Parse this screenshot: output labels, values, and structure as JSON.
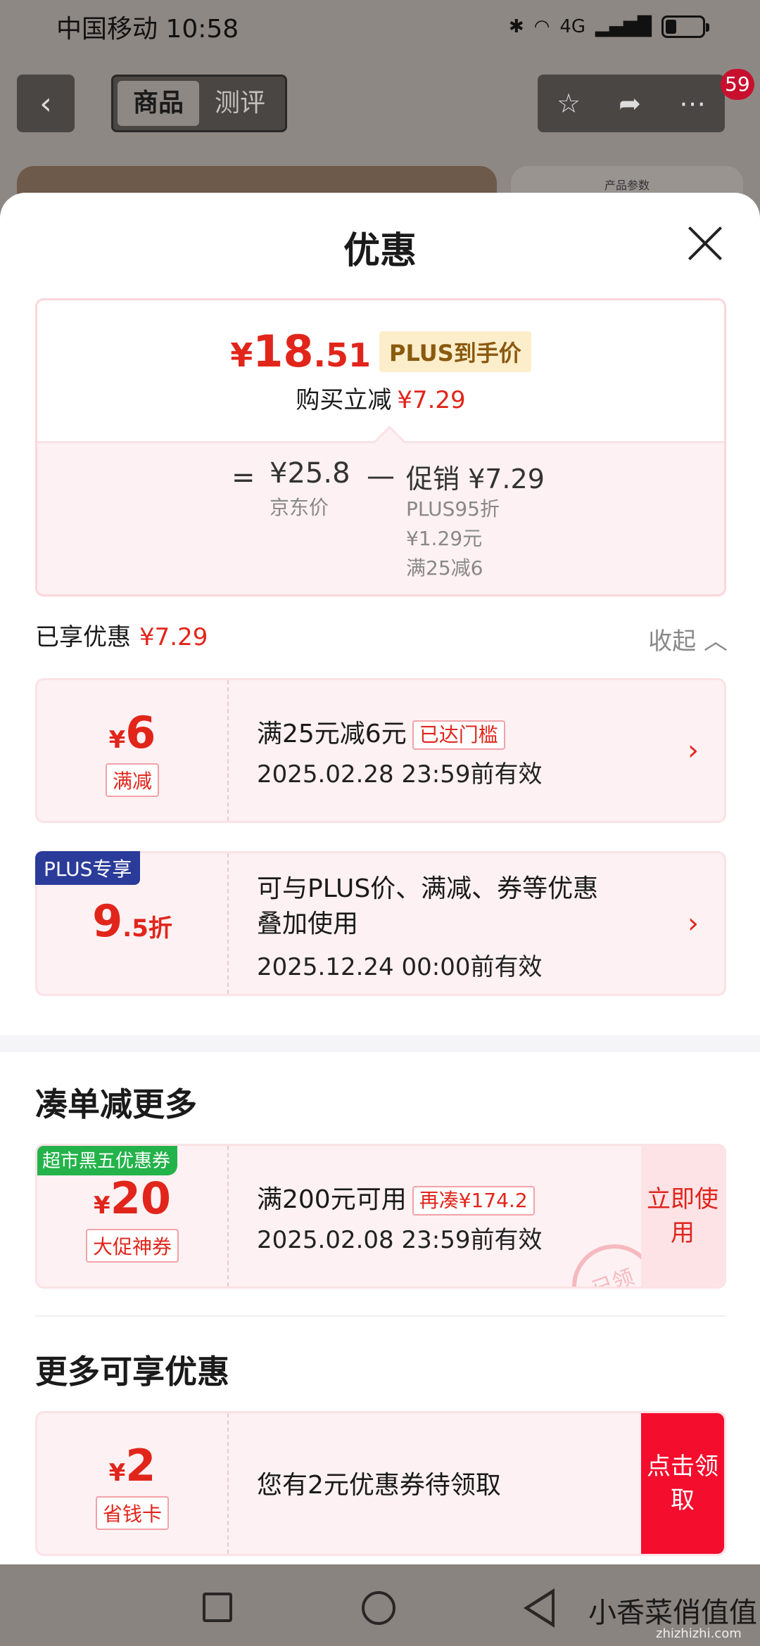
{
  "status_bar": {
    "carrier_time": "中国移动 10:58",
    "network": "4G",
    "icons": [
      "bluetooth-icon",
      "wifi-icon",
      "signal-icon",
      "battery-icon"
    ],
    "battery_level": 0.3
  },
  "top_nav": {
    "tabs": [
      "商品",
      "测评"
    ],
    "active_tab": 0,
    "badge": "59",
    "right_panel_text": "产品参数"
  },
  "sheet": {
    "title": "优惠",
    "price": {
      "yen": "¥",
      "int": "18",
      "dec": ".51",
      "tag": "PLUS到手价"
    },
    "reduce": {
      "label": "购买立减",
      "amount": "¥7.29"
    },
    "breakdown": {
      "eq": "=",
      "jd_price": "¥25.8",
      "jd_label": "京东价",
      "minus": "—",
      "promo": "促销 ¥7.29",
      "lines": [
        "PLUS95折",
        "¥1.29元",
        "满25减6"
      ]
    },
    "enjoyed": {
      "label": "已享优惠",
      "amount": "¥7.29"
    },
    "collapse_label": "收起 ︿",
    "coupons": [
      {
        "yen": "¥",
        "num": "6",
        "suffix": "",
        "tag": "满减",
        "text": "满25元减6元",
        "status_tag": "已达门槛",
        "date": "2025.02.28 23:59前有效"
      },
      {
        "corner": "PLUS专享",
        "yen": "",
        "num": "9",
        "suffix": ".5折",
        "text1": "可与PLUS价、满减、券等优惠",
        "text2": "叠加使用",
        "date": "2025.12.24 00:00前有效"
      }
    ],
    "section1": {
      "title": "凑单减更多",
      "coupon": {
        "corner": "超市黑五优惠券",
        "yen": "¥",
        "num": "20",
        "tag": "大促神券",
        "text": "满200元可用",
        "status_tag": "再凑¥174.2",
        "date": "2025.02.08 23:59前有效",
        "action": "立即使用",
        "stamp": "已领"
      }
    },
    "section2": {
      "title": "更多可享优惠",
      "coupon": {
        "yen": "¥",
        "num": "2",
        "tag": "省钱卡",
        "text": "您有2元优惠券待领取",
        "action": "点击领取"
      }
    }
  },
  "watermark": {
    "text": "小香菜俏值值",
    "sub": "zhizhizhi.com"
  }
}
